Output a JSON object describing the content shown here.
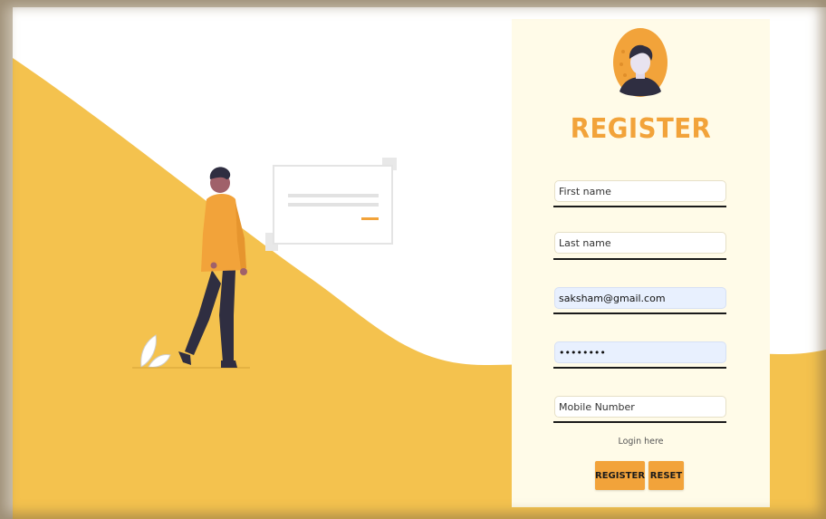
{
  "colors": {
    "accent": "#f2a33a",
    "wave": "#f4c24e",
    "card_bg": "#fffbe8",
    "autofill_bg": "#e8f0fe"
  },
  "form": {
    "title": "REGISTER",
    "first_name": {
      "placeholder": "First name",
      "value": ""
    },
    "last_name": {
      "placeholder": "Last name",
      "value": ""
    },
    "email": {
      "placeholder": "",
      "value": "saksham@gmail.com"
    },
    "password": {
      "placeholder": "",
      "value": "password"
    },
    "mobile": {
      "placeholder": "Mobile Number",
      "value": ""
    },
    "login_link": "Login here",
    "register_button": "REGISTER",
    "reset_button": "RESET"
  },
  "icons": {
    "avatar": "user-avatar-icon",
    "illustration": "person-with-message-illustration"
  }
}
